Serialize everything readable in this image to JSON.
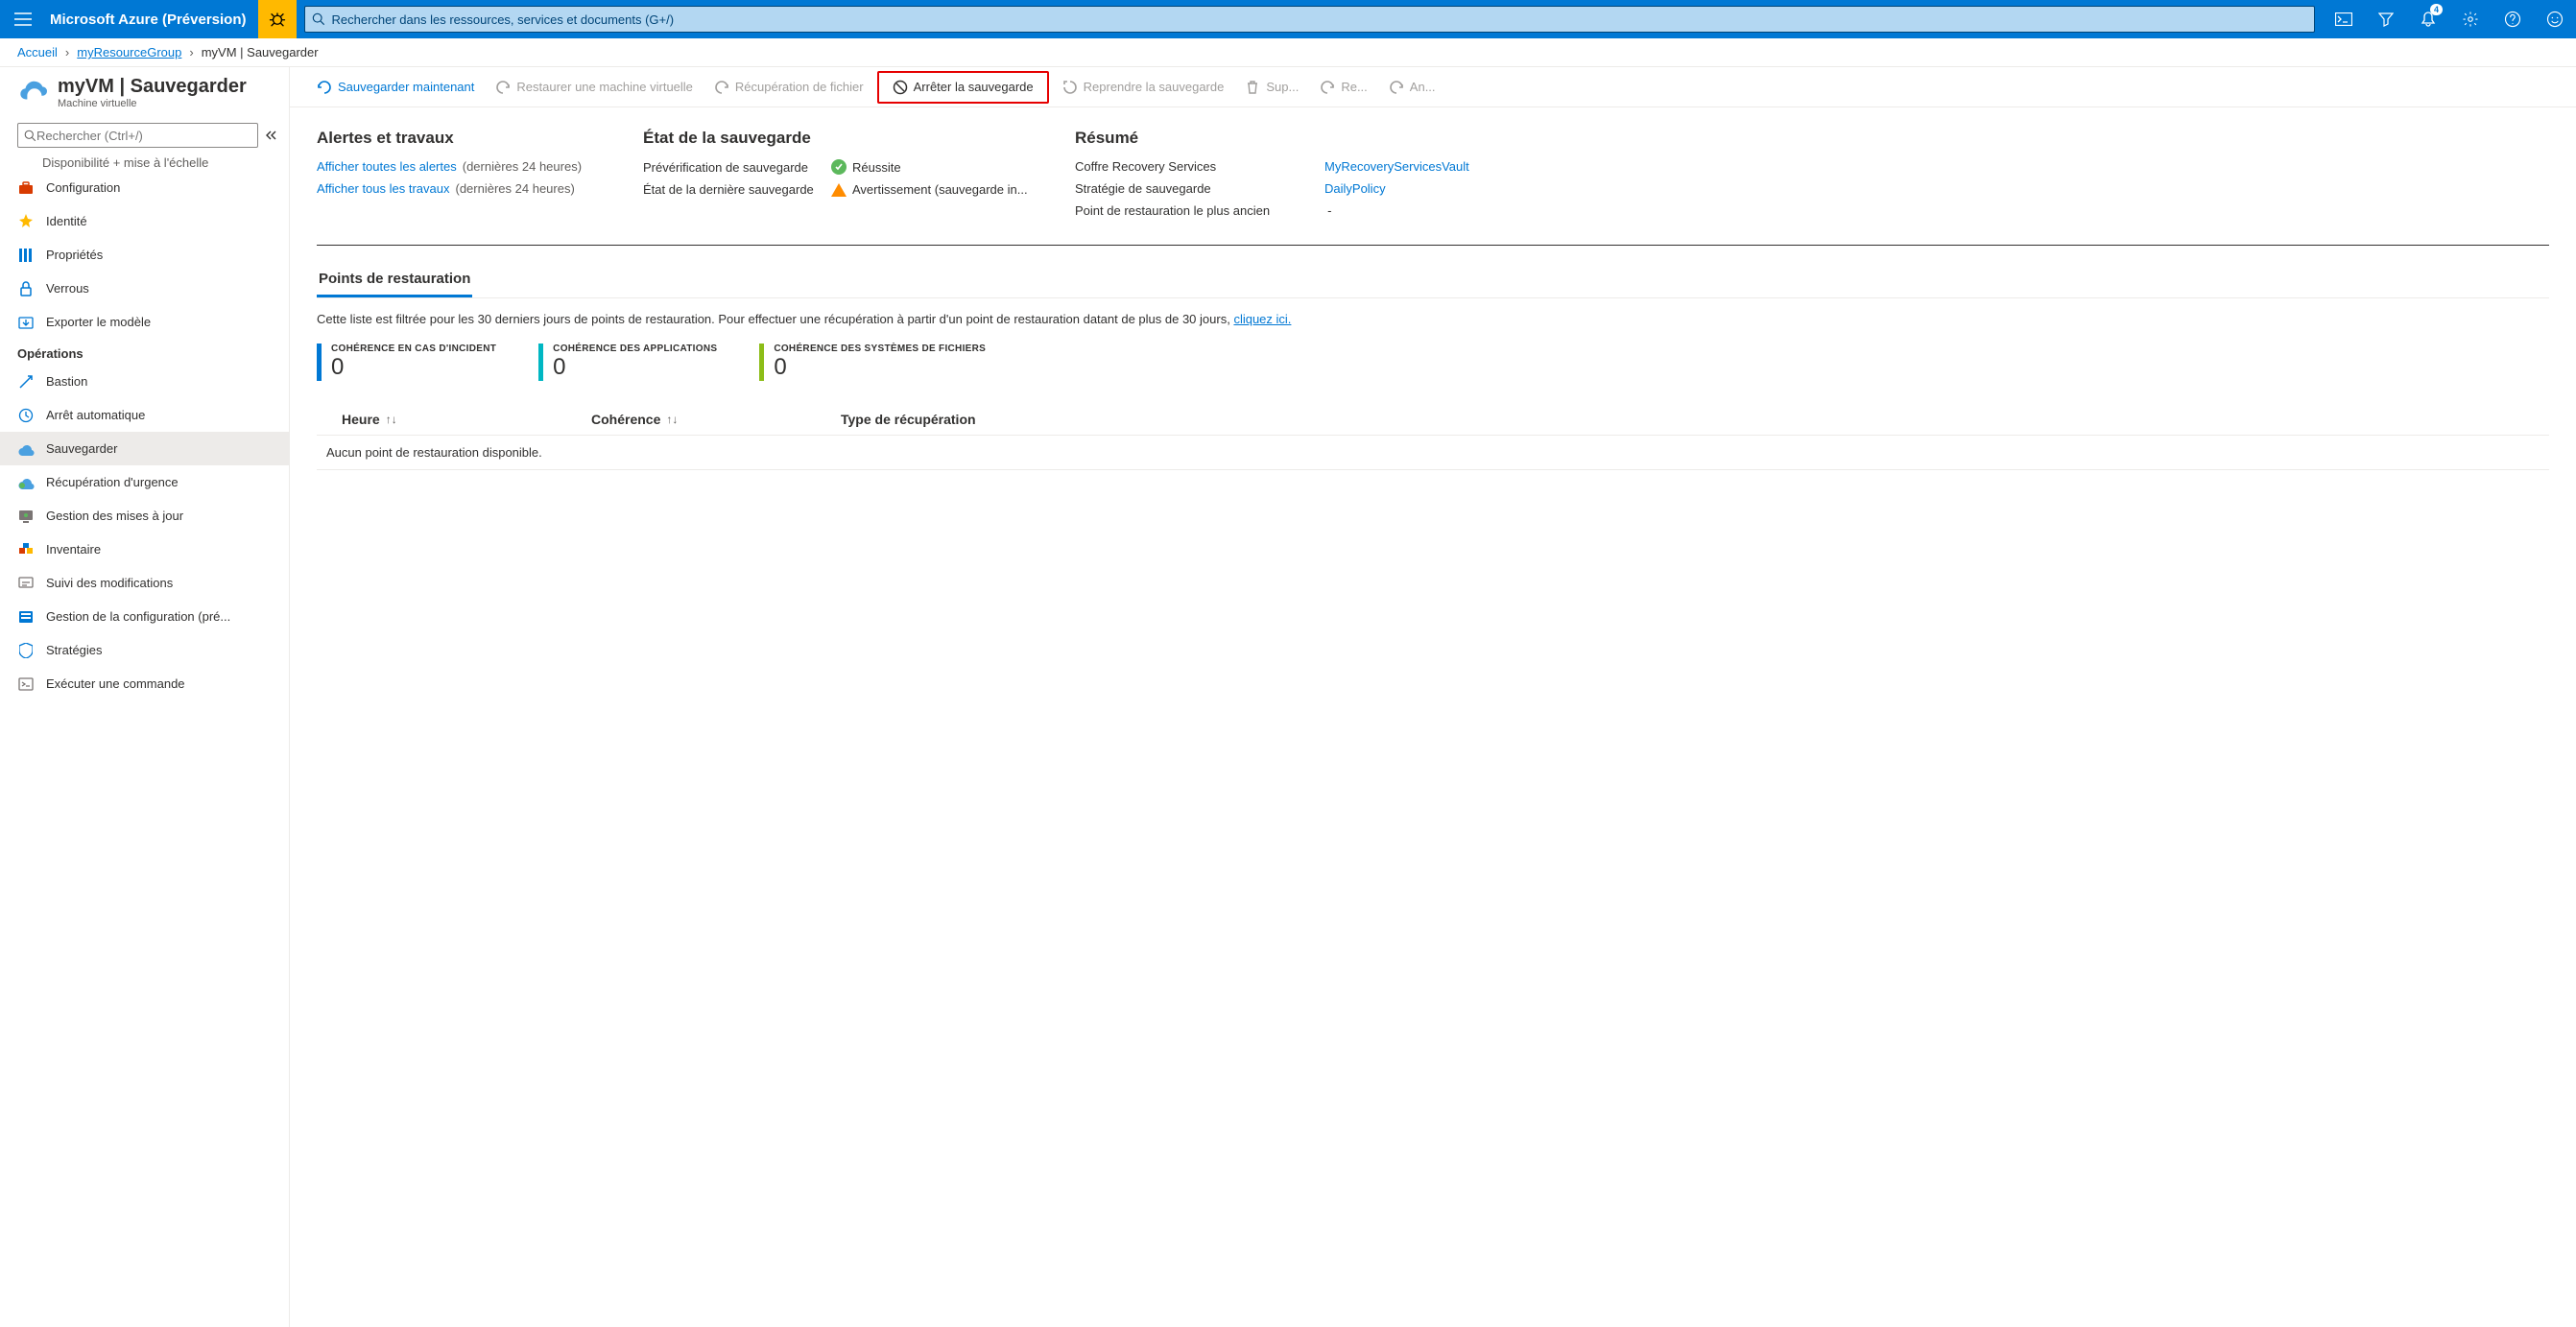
{
  "topbar": {
    "brand": "Microsoft Azure (Préversion)",
    "search_placeholder": "Rechercher dans les ressources, services et documents (G+/)",
    "notification_count": "4"
  },
  "breadcrumb": {
    "home": "Accueil",
    "rg": "myResourceGroup",
    "tail": "myVM | Sauvegarder"
  },
  "header": {
    "title": "myVM | Sauvegarder",
    "subtitle": "Machine virtuelle"
  },
  "sidebar": {
    "search_placeholder": "Rechercher (Ctrl+/)",
    "cutoff": "Disponibilité + mise à l'échelle",
    "items1": [
      {
        "label": "Configuration"
      },
      {
        "label": "Identité"
      },
      {
        "label": "Propriétés"
      },
      {
        "label": "Verrous"
      },
      {
        "label": "Exporter le modèle"
      }
    ],
    "group1": "Opérations",
    "items2": [
      {
        "label": "Bastion"
      },
      {
        "label": "Arrêt automatique"
      },
      {
        "label": "Sauvegarder"
      },
      {
        "label": "Récupération d'urgence"
      },
      {
        "label": "Gestion des mises à jour"
      },
      {
        "label": "Inventaire"
      },
      {
        "label": "Suivi des modifications"
      },
      {
        "label": "Gestion de la configuration (pré..."
      },
      {
        "label": "Stratégies"
      },
      {
        "label": "Exécuter une commande"
      }
    ]
  },
  "toolbar": {
    "backup_now": "Sauvegarder maintenant",
    "restore_vm": "Restaurer une machine virtuelle",
    "file_recovery": "Récupération de fichier",
    "stop_backup": "Arrêter la sauvegarde",
    "resume_backup": "Reprendre la sauvegarde",
    "delete": "Sup...",
    "restore": "Re...",
    "cancel": "An..."
  },
  "alerts": {
    "title": "Alertes et travaux",
    "view_alerts": "Afficher toutes les alertes",
    "view_jobs": "Afficher tous les travaux",
    "period": "(dernières 24 heures)"
  },
  "state": {
    "title": "État de la sauvegarde",
    "precheck_label": "Prévérification de sauvegarde",
    "precheck_value": "Réussite",
    "last_backup_label": "État de la dernière sauvegarde",
    "last_backup_value": "Avertissement (sauvegarde in..."
  },
  "summary": {
    "title": "Résumé",
    "vault_label": "Coffre Recovery Services",
    "vault_value": "MyRecoveryServicesVault",
    "policy_label": "Stratégie de sauvegarde",
    "policy_value": "DailyPolicy",
    "oldest_label": "Point de restauration le plus ancien",
    "oldest_value": "-"
  },
  "restore": {
    "tab": "Points de restauration",
    "filter_text": "Cette liste est filtrée pour les 30 derniers jours de points de restauration. Pour effectuer une récupération à partir d'un point de restauration datant de plus de 30 jours, ",
    "filter_link": "cliquez ici.",
    "c1_label": "COHÉRENCE EN CAS D'INCIDENT",
    "c1_value": "0",
    "c2_label": "COHÉRENCE DES APPLICATIONS",
    "c2_value": "0",
    "c3_label": "COHÉRENCE DES SYSTÈMES DE FICHIERS",
    "c3_value": "0",
    "col_time": "Heure",
    "col_consistency": "Cohérence",
    "col_type": "Type de récupération",
    "empty": "Aucun point de restauration disponible."
  }
}
